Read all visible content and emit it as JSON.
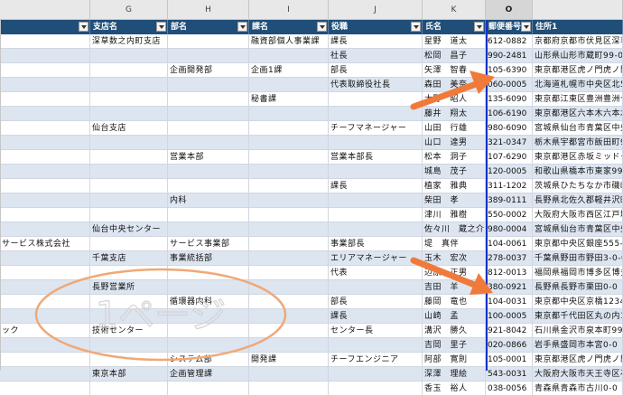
{
  "column_letters": [
    "G",
    "H",
    "I",
    "J",
    "K",
    "O"
  ],
  "headers": {
    "g": "支店名",
    "h": "部名",
    "i": "課名",
    "j": "役職",
    "k": "氏名",
    "o": "郵便番号",
    "p": "住所1"
  },
  "rows": [
    {
      "f": "",
      "g": "深草数之内町支店",
      "h": "",
      "i": "融資部個人事業課",
      "j": "課長",
      "k": "星野　道太",
      "o": "612-0882",
      "p": "京都府京都市伏見区深草"
    },
    {
      "f": "",
      "g": "",
      "h": "",
      "i": "",
      "j": "社長",
      "k": "松岡　昌子",
      "o": "990-2481",
      "p": "山形県山形市蔵町99-0-0"
    },
    {
      "f": "",
      "g": "",
      "h": "企画開発部",
      "i": "企画1課",
      "j": "部長",
      "k": "矢澤　智春",
      "o": "105-6390",
      "p": "東京都港区虎ノ門虎ノ門"
    },
    {
      "f": "",
      "g": "",
      "h": "",
      "i": "",
      "j": "代表取締役社長",
      "k": "森田　美奈",
      "o": "060-0005",
      "p": "北海道札幌市中央区北5"
    },
    {
      "f": "",
      "g": "",
      "h": "",
      "i": "秘書課",
      "j": "",
      "k": "大野　昭人",
      "o": "135-6090",
      "p": "東京都江東区豊洲豊洲セ"
    },
    {
      "f": "",
      "g": "",
      "h": "",
      "i": "",
      "j": "",
      "k": "藤井　翔太",
      "o": "106-6190",
      "p": "東京都港区六本木六本木"
    },
    {
      "f": "",
      "g": "仙台支店",
      "h": "",
      "i": "",
      "j": "チーフマネージャー",
      "k": "山田　行雄",
      "o": "980-6090",
      "p": "宮城県仙台市青葉区中央"
    },
    {
      "f": "",
      "g": "",
      "h": "",
      "i": "",
      "j": "",
      "k": "山口　達男",
      "o": "321-0347",
      "p": "栃木県宇都宮市飯田町99"
    },
    {
      "f": "",
      "g": "",
      "h": "営業本部",
      "i": "",
      "j": "営業本部長",
      "k": "松本　洞子",
      "o": "107-6290",
      "p": "東京都港区赤坂ミッドタ"
    },
    {
      "f": "",
      "g": "",
      "h": "",
      "i": "",
      "j": "",
      "k": "城島　茂子",
      "o": "120-0005",
      "p": "和歌山県橋本市東家99-"
    },
    {
      "f": "",
      "g": "",
      "h": "",
      "i": "",
      "j": "課長",
      "k": "植家　雅典",
      "o": "311-1202",
      "p": "茨城県ひたちなか市磯崎"
    },
    {
      "f": "",
      "g": "",
      "h": "内科",
      "i": "",
      "j": "",
      "k": "柴田　孝",
      "o": "389-0111",
      "p": "長野県北佐久郡軽井沢町"
    },
    {
      "f": "",
      "g": "",
      "h": "",
      "i": "",
      "j": "",
      "k": "津川　雅樹",
      "o": "550-0002",
      "p": "大阪府大阪市西区江戸堀"
    },
    {
      "f": "",
      "g": "仙台中央センター",
      "h": "",
      "i": "",
      "j": "",
      "k": "佐々川　蔵之介",
      "o": "980-0004",
      "p": "宮城県仙台市青葉区中央"
    },
    {
      "f": "サービス株式会社",
      "g": "",
      "h": "サービス事業部",
      "i": "",
      "j": "事業部長",
      "k": "堤　真伴",
      "o": "104-0061",
      "p": "東京都中央区銀座555-0"
    },
    {
      "f": "",
      "g": "千葉支店",
      "h": "事業統括部",
      "i": "",
      "j": "エリアマネージャー",
      "k": "玉木　宏次",
      "o": "278-0037",
      "p": "千葉県野田市野田3-0-0"
    },
    {
      "f": "",
      "g": "",
      "h": "",
      "i": "",
      "j": "代表",
      "k": "辺原　正男",
      "o": "812-0013",
      "p": "福岡県福岡市博多区博多"
    },
    {
      "f": "",
      "g": "長野営業所",
      "h": "",
      "i": "",
      "j": "",
      "k": "吉田　羊",
      "o": "380-0921",
      "p": "長野県長野市栗田0-0"
    },
    {
      "f": "",
      "g": "",
      "h": "循環器内科",
      "i": "",
      "j": "部長",
      "k": "藤岡　竜也",
      "o": "104-0031",
      "p": "東京都中央区京橋1234-"
    },
    {
      "f": "",
      "g": "",
      "h": "",
      "i": "",
      "j": "課長",
      "k": "山崎　孟",
      "o": "100-0005",
      "p": "東京都千代田区丸の内1"
    },
    {
      "f": "ック",
      "g": "技術センター",
      "h": "",
      "i": "",
      "j": "センター長",
      "k": "溝沢　勝久",
      "o": "921-8042",
      "p": "石川県金沢市泉本町999"
    },
    {
      "f": "",
      "g": "",
      "h": "",
      "i": "",
      "j": "",
      "k": "吉岡　里子",
      "o": "020-0866",
      "p": "岩手県盛岡市本宮0-0"
    },
    {
      "f": "",
      "g": "",
      "h": "システム部",
      "i": "開発課",
      "j": "チーフエンジニア",
      "k": "阿部　寛則",
      "o": "105-0001",
      "p": "東京都港区虎ノ門虎ノ門"
    },
    {
      "f": "",
      "g": "東京本部",
      "h": "企画管理課",
      "i": "",
      "j": "",
      "k": "深澤　理絵",
      "o": "543-0031",
      "p": "大阪府大阪市天王寺区石"
    },
    {
      "f": "",
      "g": "",
      "h": "",
      "i": "",
      "j": "",
      "k": "香玉　裕人",
      "o": "038-0056",
      "p": "青森県青森市古川0-0"
    }
  ],
  "watermark": "1ページ",
  "colors": {
    "header_bg": "#1f4e79",
    "stripe": "#dde5f0",
    "page_break": "#1431c4",
    "arrow": "#f07a3a",
    "watermark": "#f0a878"
  }
}
